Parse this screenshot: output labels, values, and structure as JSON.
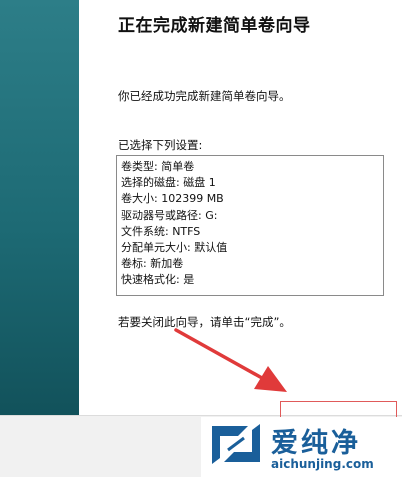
{
  "wizard": {
    "title": "正在完成新建简单卷向导",
    "intro": "你已经成功完成新建简单卷向导。",
    "settings_label": "已选择下列设置:",
    "settings": [
      "卷类型: 简单卷",
      "选择的磁盘: 磁盘 1",
      "卷大小: 102399 MB",
      "驱动器号或路径: G:",
      "文件系统: NTFS",
      "分配单元大小: 默认值",
      "卷标: 新加卷",
      "快速格式化: 是"
    ],
    "finish_hint": "若要关闭此向导，请单击“完成”。"
  },
  "watermark": {
    "name": "爱纯净",
    "domain": "aichunjing.com"
  },
  "colors": {
    "sidebar": "#1d6a74",
    "annotation": "#e03a3a",
    "watermark": "#1a5f9a"
  }
}
